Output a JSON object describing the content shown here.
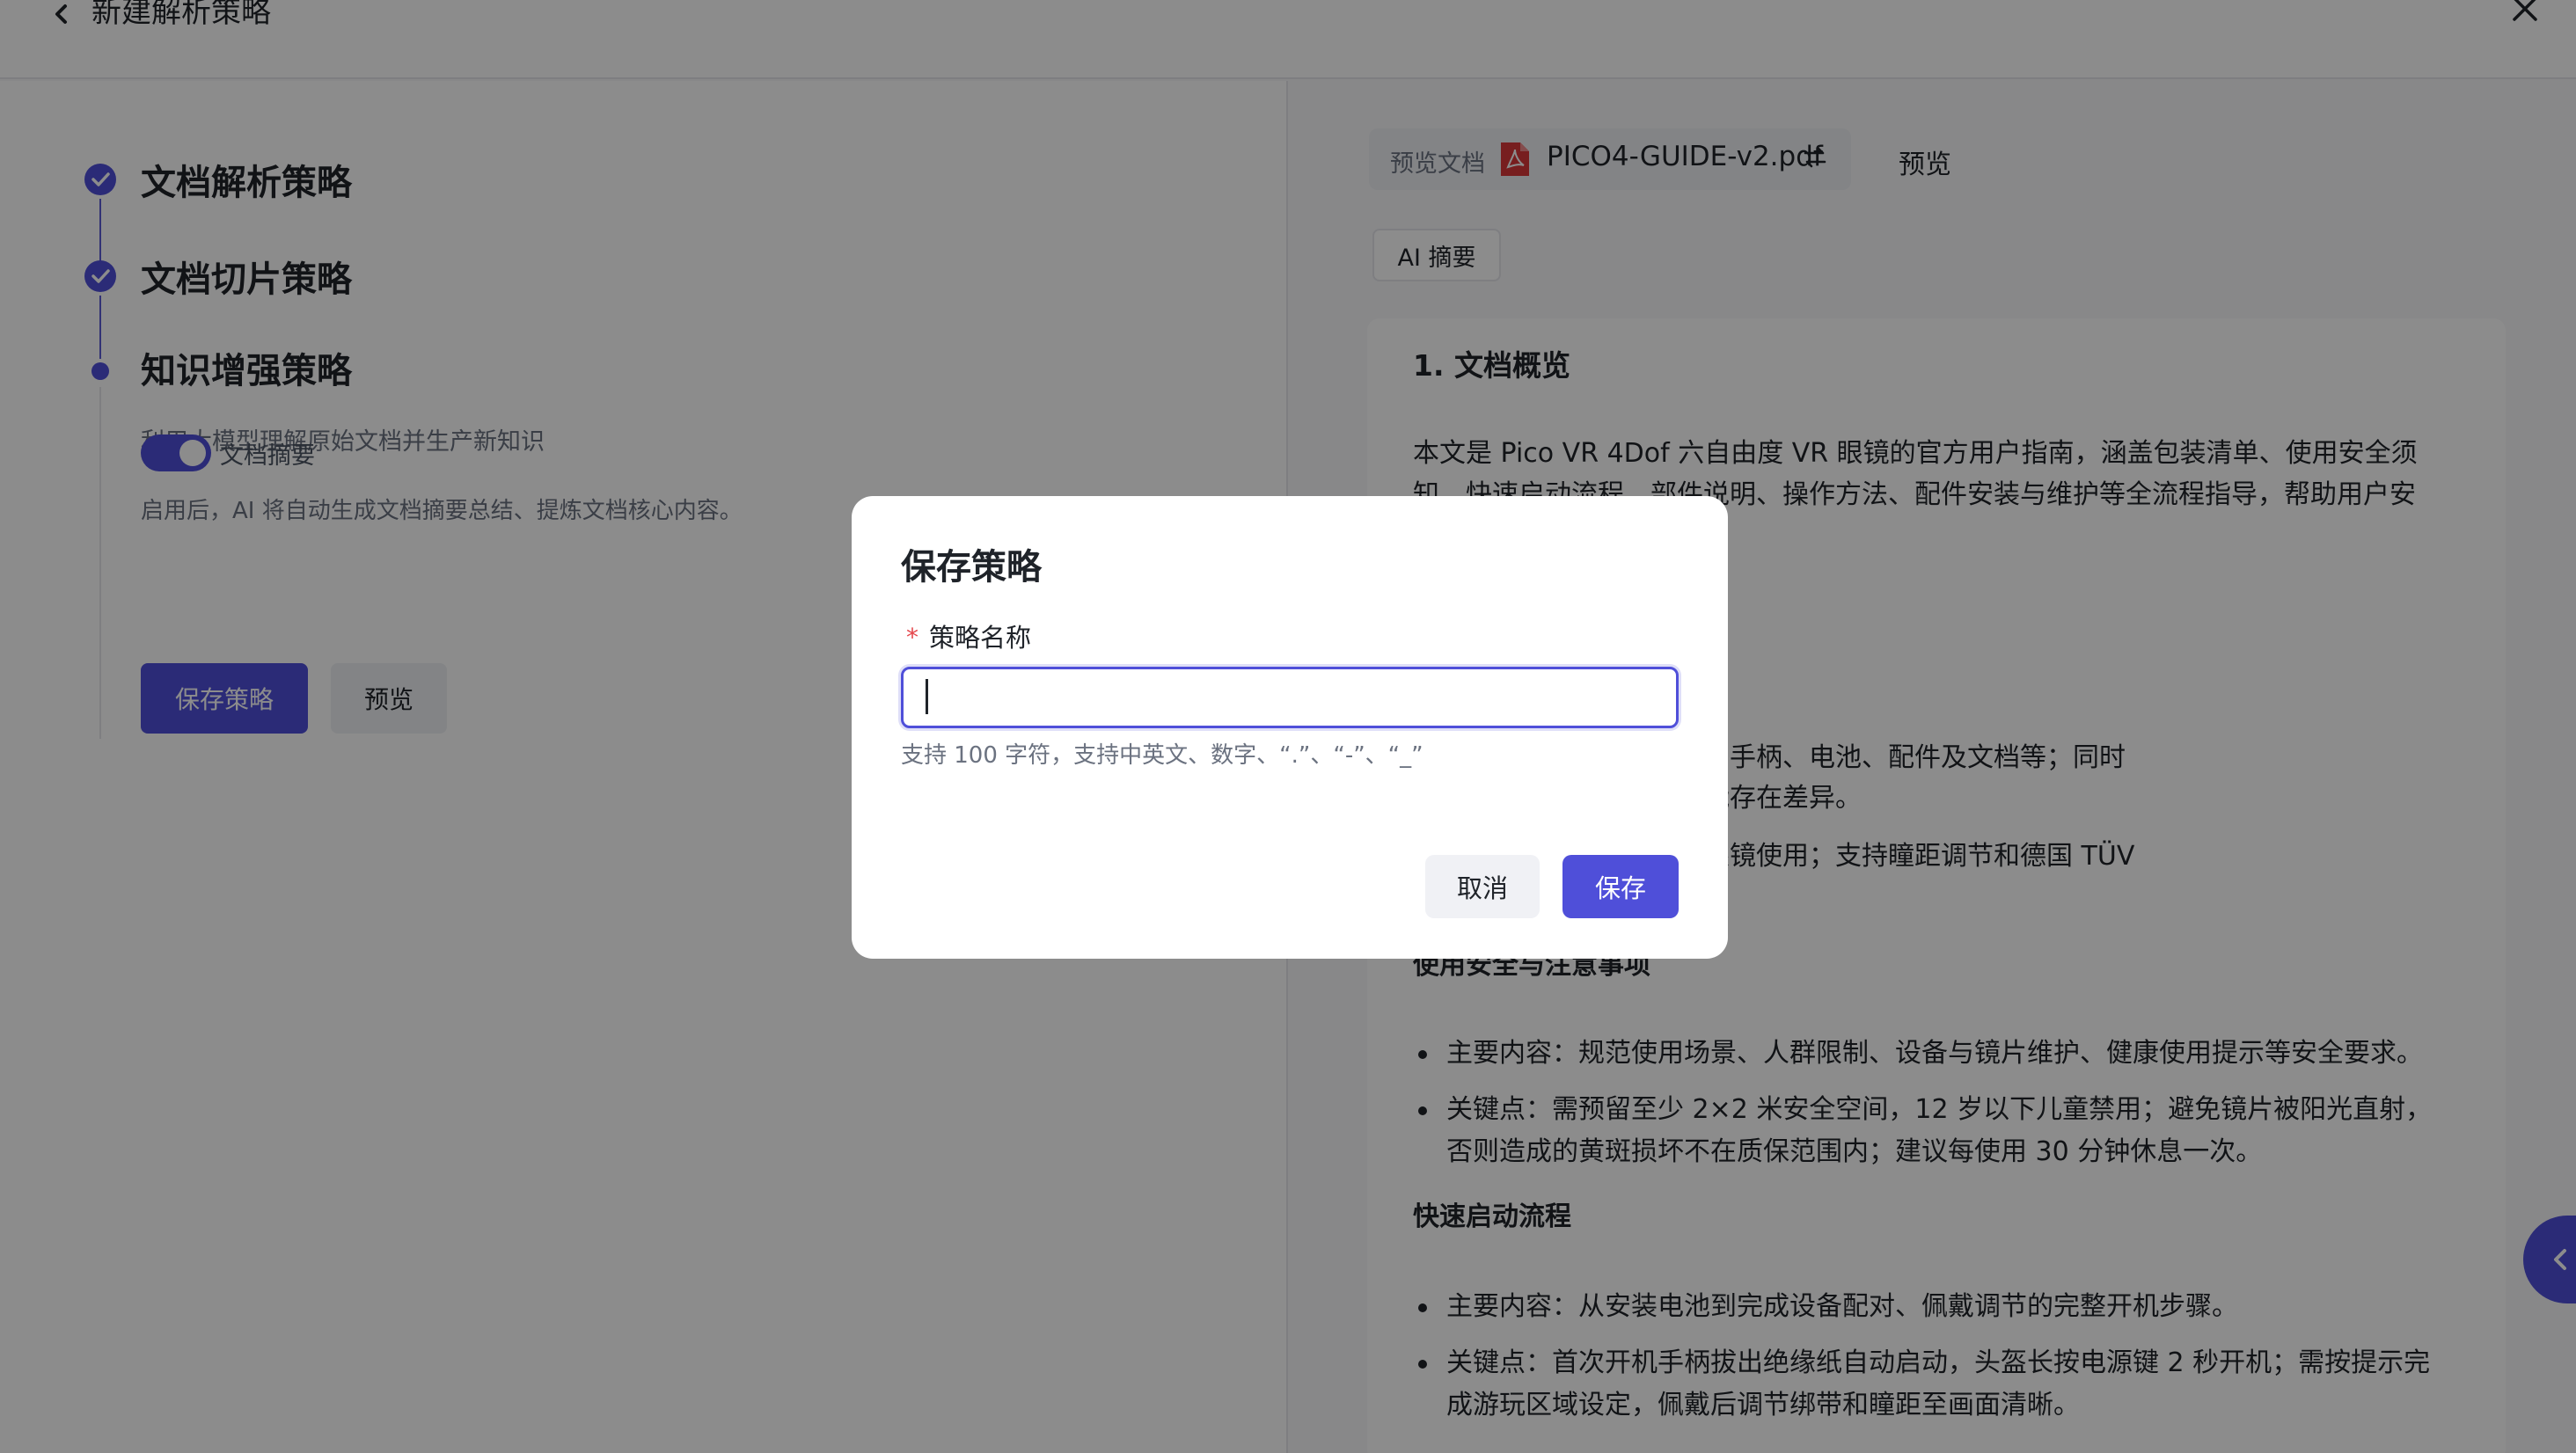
{
  "header": {
    "title": "新建解析策略"
  },
  "steps": [
    {
      "title": "文档解析策略",
      "status": "done"
    },
    {
      "title": "文档切片策略",
      "status": "done"
    },
    {
      "title": "知识增强策略",
      "status": "active",
      "desc": "利用大模型理解原始文档并生产新知识"
    }
  ],
  "summary_toggle": {
    "label": "文档摘要",
    "on": true,
    "desc": "启用后，AI 将自动生成文档摘要总结、提炼文档核心内容。"
  },
  "left_buttons": {
    "save": "保存策略",
    "preview": "预览"
  },
  "preview_panel": {
    "doc_label": "预览文档",
    "doc_name": "PICO4-GUIDE-v2.pdf",
    "preview_link": "预览",
    "ai_tag": "AI 摘要",
    "content": {
      "heading": "1. 文档概览",
      "para1_line1": "本文是 Pico VR 4Dof 六自由度 VR 眼镜的官方用户指南，涵盖包装清单、使用安全须",
      "para1_line2": "知、快速启动流程、部件说明、操作方法、配件安装与维护等全流程指导，帮助用户安",
      "para1_line3": "。",
      "frag1_line1": "配的全套配件，包含头盔、手柄、电池、配件及文档等；同时",
      "frag1_line2": "物为准，部分地区包装可能存在差异。",
      "frag2_line1": "视调节功能，需搭配标准眼镜使用；支持瞳距调节和德国 TÜV",
      "section_safety": "使用安全与注意事项",
      "safety_b1": "主要内容：规范使用场景、人群限制、设备与镜片维护、健康使用提示等安全要求。",
      "safety_b2_line1": "关键点：需预留至少 2×2 米安全空间，12 岁以下儿童禁用；避免镜片被阳光直射，",
      "safety_b2_line2": "否则造成的黄斑损坏不在质保范围内；建议每使用 30 分钟休息一次。",
      "section_quick": "快速启动流程",
      "quick_b1": "主要内容：从安装电池到完成设备配对、佩戴调节的完整开机步骤。",
      "quick_b2_line1": "关键点：首次开机手柄拔出绝缘纸自动启动，头盔长按电源键 2 秒开机；需按提示完",
      "quick_b2_line2": "成游玩区域设定，佩戴后调节绑带和瞳距至画面清晰。"
    }
  },
  "modal": {
    "title": "保存策略",
    "required_mark": "*",
    "field_label": "策略名称",
    "input_value": "",
    "help_text": "支持 100 字符，支持中英文、数字、“.”、“-”、“_”",
    "cancel": "取消",
    "save": "保存"
  },
  "colors": {
    "accent": "#4f4fd9",
    "overlay": "rgba(0,0,0,0.45)",
    "required": "#e5484d"
  }
}
